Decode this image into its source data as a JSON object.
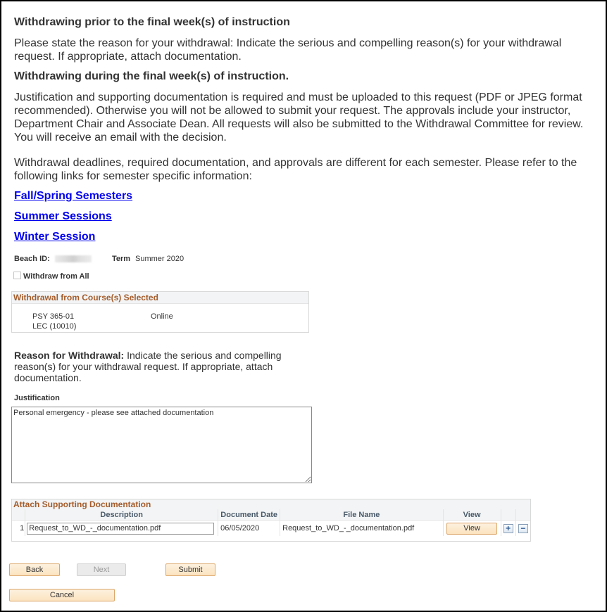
{
  "intro": {
    "heading_prior": "Withdrawing prior to the final week(s) of instruction",
    "para_prior": "Please state the reason for your withdrawal: Indicate the serious and compelling reason(s) for your withdrawal request. If appropriate, attach documentation.",
    "heading_during": "Withdrawing during the final week(s) of instruction.",
    "para_during": "Justification and supporting documentation is required and must be uploaded to this request (PDF or JPEG format recommended). Otherwise you will not be allowed to submit your request. The approvals include your instructor, Department Chair and Associate Dean. All requests will also be submitted to the Withdrawal Committee for review. You will receive an email with the decision.",
    "para_deadlines": "Withdrawal deadlines, required documentation, and approvals are different for each semester. Please refer to the following links for semester specific information:"
  },
  "links": [
    {
      "label": "Fall/Spring Semesters"
    },
    {
      "label": "Summer Sessions"
    },
    {
      "label": "Winter Session"
    }
  ],
  "student": {
    "beach_id_label": "Beach ID:",
    "beach_id_value": "",
    "term_label": "Term",
    "term_value": "Summer 2020"
  },
  "withdraw_all": {
    "label": "Withdraw from All",
    "checked": false
  },
  "courses_box": {
    "title": "Withdrawal from Course(s) Selected",
    "courses": [
      {
        "course": "PSY 365-01",
        "section": "LEC (10010)",
        "mode": "Online"
      }
    ]
  },
  "reason": {
    "label": "Reason for Withdrawal:",
    "text": " Indicate the serious and compelling reason(s) for your withdrawal request. If appropriate, attach documentation."
  },
  "justification": {
    "label": "Justification",
    "value": "Personal emergency - please see attached documentation"
  },
  "attachments": {
    "title": "Attach Supporting Documentation",
    "columns": [
      "",
      "Description",
      "Document Date",
      "File Name",
      "View",
      "",
      ""
    ],
    "rows": [
      {
        "index": "1",
        "description": "Request_to_WD_-_documentation.pdf",
        "document_date": "06/05/2020",
        "file_name": "Request_to_WD_-_documentation.pdf",
        "view_label": "View",
        "add_icon": "plus-icon",
        "delete_icon": "minus-icon"
      }
    ]
  },
  "buttons": {
    "back": "Back",
    "next": "Next",
    "next_disabled": true,
    "submit": "Submit",
    "cancel": "Cancel"
  },
  "colors": {
    "link": "#0000ee",
    "group_title": "#a55c2b",
    "button_bg": "#fbe3bf",
    "button_border": "#dba66a"
  }
}
